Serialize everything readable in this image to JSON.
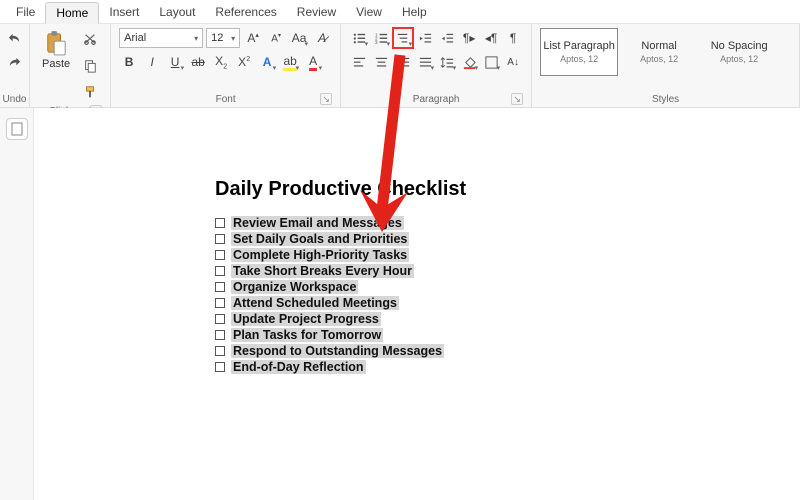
{
  "menu": {
    "file": "File",
    "home": "Home",
    "insert": "Insert",
    "layout": "Layout",
    "references": "References",
    "review": "Review",
    "view": "View",
    "help": "Help"
  },
  "ribbon": {
    "undo_label": "Undo",
    "clipboard": {
      "paste": "Paste",
      "label": "Clipboard"
    },
    "font": {
      "name": "Arial",
      "size": "12",
      "label": "Font"
    },
    "paragraph": {
      "label": "Paragraph"
    },
    "styles": {
      "label": "Styles",
      "items": [
        {
          "name": "List Paragraph",
          "mini": "Aptos, 12",
          "active": true
        },
        {
          "name": "Normal",
          "mini": "Aptos, 12",
          "active": false
        },
        {
          "name": "No Spacing",
          "mini": "Aptos, 12",
          "active": false
        }
      ]
    }
  },
  "document": {
    "title": "Daily Productive Checklist",
    "items": [
      "Review Email and Messages",
      "Set Daily Goals and Priorities",
      " Complete High-Priority Tasks",
      "Take Short Breaks Every Hour",
      "Organize Workspace",
      " Attend Scheduled Meetings",
      "Update Project Progress",
      " Plan Tasks for Tomorrow",
      "Respond to Outstanding Messages",
      "End-of-Day Reflection"
    ]
  }
}
